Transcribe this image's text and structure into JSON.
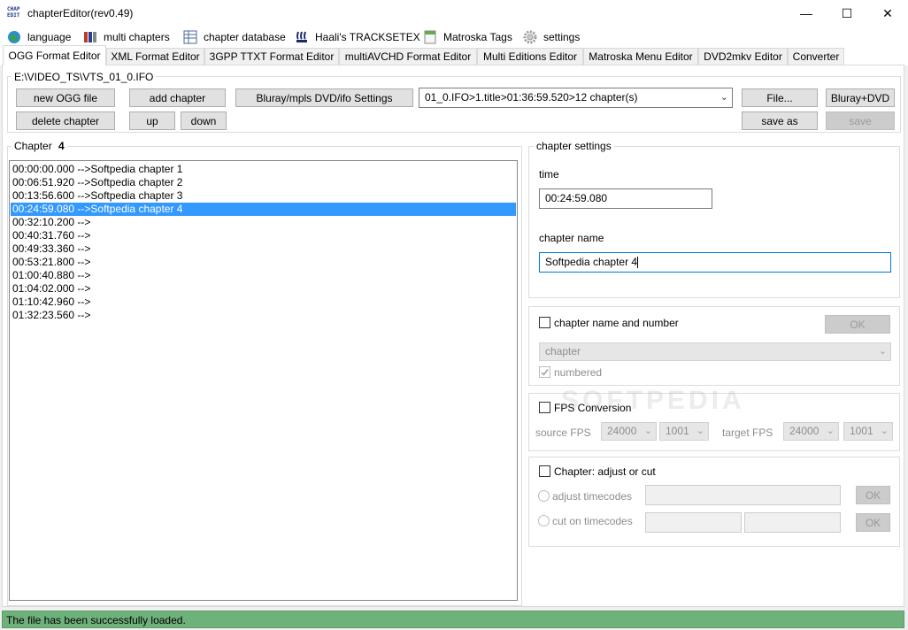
{
  "window": {
    "title": "chapterEditor(rev0.49)"
  },
  "menu": [
    {
      "label": "language",
      "icon": "globe-icon"
    },
    {
      "label": "multi chapters",
      "icon": "books-icon"
    },
    {
      "label": "chapter database",
      "icon": "table-icon"
    },
    {
      "label": "Haali's TRACKSETEX",
      "icon": "matroska-icon"
    },
    {
      "label": "Matroska Tags",
      "icon": "document-icon"
    },
    {
      "label": "settings",
      "icon": "gear-icon"
    }
  ],
  "tabs": [
    {
      "label": "OGG Format Editor",
      "active": true
    },
    {
      "label": "XML Format Editor"
    },
    {
      "label": "3GPP TTXT Format Editor"
    },
    {
      "label": "multiAVCHD Format Editor"
    },
    {
      "label": "Multi Editions Editor"
    },
    {
      "label": "Matroska Menu Editor"
    },
    {
      "label": "DVD2mkv Editor"
    },
    {
      "label": "Converter"
    }
  ],
  "file_group": {
    "path": "E:\\VIDEO_TS\\VTS_01_0.IFO",
    "new_ogg": "new OGG file",
    "add_chapter": "add chapter",
    "settings_btn": "Bluray/mpls DVD/ifo Settings",
    "title_select": "01_0.IFO>1.title>01:36:59.520>12 chapter(s)",
    "file_btn": "File...",
    "bluray_dvd": "Bluray+DVD",
    "delete_chapter": "delete chapter",
    "up": "up",
    "down": "down",
    "save_as": "save as",
    "save": "save"
  },
  "chapter_group": {
    "label": "Chapter",
    "number": "4",
    "items": [
      "00:00:00.000 -->Softpedia chapter 1",
      "00:06:51.920 -->Softpedia chapter 2",
      "00:13:56.600 -->Softpedia chapter 3",
      "00:24:59.080 -->Softpedia chapter 4",
      "00:32:10.200 -->",
      "00:40:31.760 -->",
      "00:49:33.360 -->",
      "00:53:21.800 -->",
      "01:00:40.880 -->",
      "01:04:02.000 -->",
      "01:10:42.960 -->",
      "01:32:23.560 -->"
    ],
    "selected_index": 3
  },
  "chapter_settings": {
    "title": "chapter settings",
    "time_label": "time",
    "time_value": "00:24:59.080",
    "name_label": "chapter name",
    "name_value": "Softpedia chapter 4"
  },
  "name_number": {
    "label": "chapter name and number",
    "ok": "OK",
    "combo_value": "chapter",
    "numbered": "numbered"
  },
  "fps": {
    "label": "FPS Conversion",
    "source_label": "source FPS",
    "source_value": "24000",
    "source_den": "1001",
    "target_label": "target FPS",
    "target_value": "24000",
    "target_den": "1001"
  },
  "adjust": {
    "label": "Chapter: adjust or cut",
    "adjust_label": "adjust timecodes",
    "cut_label": "cut on timecodes",
    "ok": "OK"
  },
  "status": {
    "text": "The file has been successfully loaded."
  },
  "watermark": "SOFTPEDIA",
  "colors": {
    "selection": "#3399ff",
    "status": "#6fb17a",
    "focus": "#0078d7"
  }
}
